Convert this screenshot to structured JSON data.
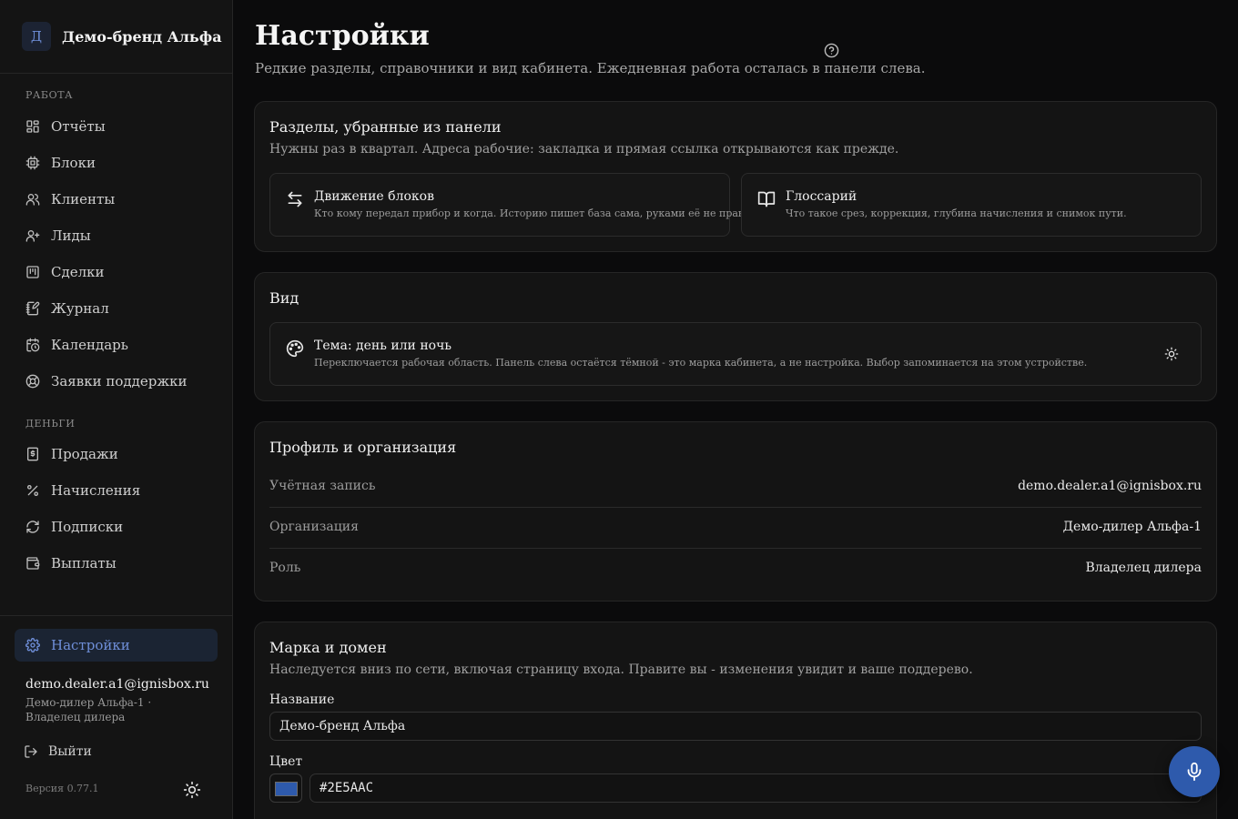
{
  "brand": {
    "initial": "Д",
    "name": "Демо-бренд Альфа"
  },
  "sidebar": {
    "sections": [
      {
        "label": "РАБОТА",
        "items": [
          {
            "label": "Отчёты",
            "icon": "dashboard-icon"
          },
          {
            "label": "Блоки",
            "icon": "chip-icon"
          },
          {
            "label": "Клиенты",
            "icon": "users-icon"
          },
          {
            "label": "Лиды",
            "icon": "user-plus-icon"
          },
          {
            "label": "Сделки",
            "icon": "kanban-icon"
          },
          {
            "label": "Журнал",
            "icon": "notebook-pen-icon"
          },
          {
            "label": "Календарь",
            "icon": "calendar-clock-icon"
          },
          {
            "label": "Заявки поддержки",
            "icon": "life-buoy-icon"
          }
        ]
      },
      {
        "label": "ДЕНЬГИ",
        "items": [
          {
            "label": "Продажи",
            "icon": "receipt-dollar-icon"
          },
          {
            "label": "Начисления",
            "icon": "percent-icon"
          },
          {
            "label": "Подписки",
            "icon": "refresh-icon"
          },
          {
            "label": "Выплаты",
            "icon": "wallet-icon"
          }
        ]
      }
    ],
    "settings": {
      "label": "Настройки",
      "icon": "gear-icon",
      "active": true
    },
    "user": {
      "email": "demo.dealer.a1@ignisbox.ru",
      "org_role": "Демо-дилер Альфа-1 · Владелец дилера"
    },
    "logout_label": "Выйти",
    "version": "Версия 0.77.1",
    "theme_icon": "sun-icon"
  },
  "page": {
    "title": "Настройки",
    "subtitle": "Редкие разделы, справочники и вид кабинета. Ежедневная работа осталась в панели слева.",
    "help_icon": "help-circle-icon"
  },
  "sections_card": {
    "title": "Разделы, убранные из панели",
    "subtitle": "Нужны раз в квартал. Адреса рабочие: закладка и прямая ссылка открываются как прежде.",
    "tiles": [
      {
        "title": "Движение блоков",
        "subtitle": "Кто кому передал прибор и когда. Историю пишет база сама, руками её не правят.",
        "icon": "arrows-left-right-icon"
      },
      {
        "title": "Глоссарий",
        "subtitle": "Что такое срез, коррекция, глубина начисления и снимок пути.",
        "icon": "book-open-icon"
      }
    ]
  },
  "view_card": {
    "title": "Вид",
    "theme": {
      "title": "Тема: день или ночь",
      "subtitle": "Переключается рабочая область. Панель слева остаётся тёмной - это марка кабинета, а не настройка. Выбор запоминается на этом устройстве.",
      "icon": "palette-icon",
      "toggle_icon": "sun-icon"
    }
  },
  "profile_card": {
    "title": "Профиль и организация",
    "rows": [
      {
        "key": "Учётная запись",
        "value": "demo.dealer.a1@ignisbox.ru"
      },
      {
        "key": "Организация",
        "value": "Демо-дилер Альфа-1"
      },
      {
        "key": "Роль",
        "value": "Владелец дилера"
      }
    ]
  },
  "brand_card": {
    "title": "Марка и домен",
    "subtitle": "Наследуется вниз по сети, включая страницу входа. Правите вы - изменения увидит и ваше поддерево.",
    "name_label": "Название",
    "name_value": "Демо-бренд Альфа",
    "color_label": "Цвет",
    "color_value": "#2E5AAC"
  },
  "colors": {
    "accent": "#2e5aac",
    "accent_text": "#6f8fd9",
    "bg": "#0b0b0c",
    "panel": "#141414"
  },
  "mic_button": {
    "icon": "microphone-icon"
  }
}
